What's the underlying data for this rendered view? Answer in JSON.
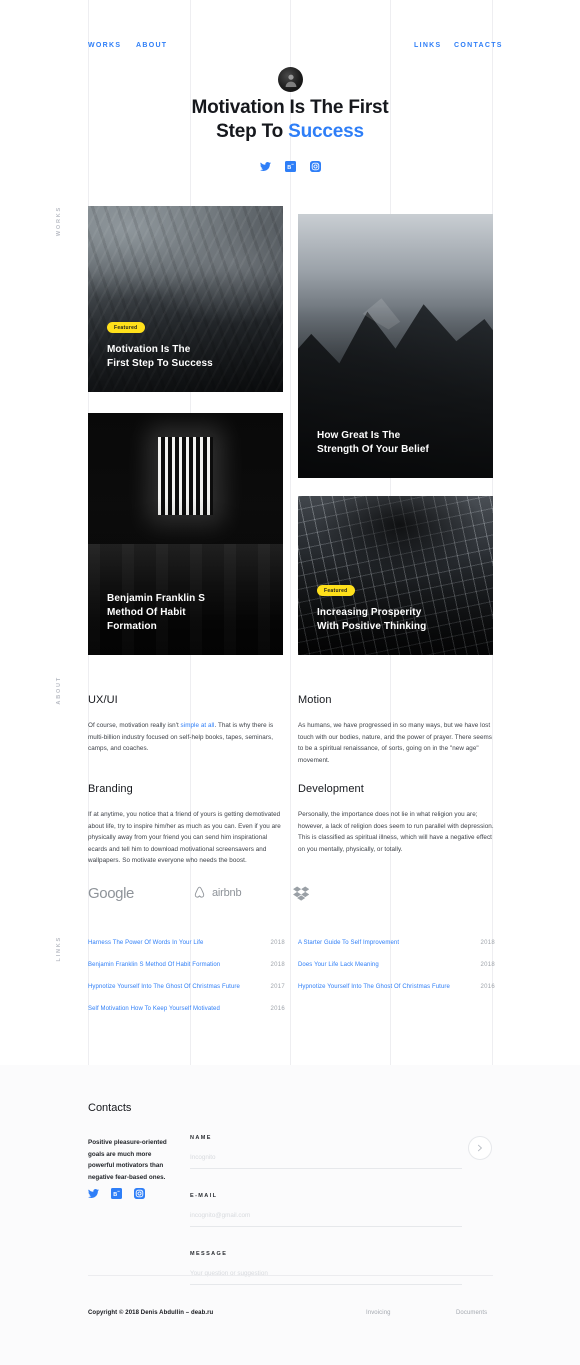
{
  "nav": {
    "works": "WORKS",
    "about": "ABOUT",
    "links": "LINKS",
    "contacts": "CONTACTS",
    "logo_icon": "avatar-logo-icon"
  },
  "hero": {
    "title_line1": "Motivation Is The First",
    "title_line2_plain": "Step To ",
    "title_line2_accent": "Success",
    "accent_color": "#2e7ef7",
    "social": [
      {
        "name": "twitter-icon",
        "label": "Twitter"
      },
      {
        "name": "behance-icon",
        "label": "Behance"
      },
      {
        "name": "instagram-icon",
        "label": "Instagram"
      }
    ]
  },
  "section_labels": {
    "works": "WORKS",
    "about": "ABOUT",
    "links": "LINKS"
  },
  "works": [
    {
      "badge": "Featured",
      "title_line1": "Motivation Is The",
      "title_line2": "First Step To Success",
      "art": "sea"
    },
    {
      "badge": "",
      "title_line1": "How Great Is The",
      "title_line2": "Strength Of Your Belief",
      "art": "mountain"
    },
    {
      "badge": "",
      "title_line1": "Benjamin Franklin S",
      "title_line2": "Method Of Habit",
      "title_line3": "Formation",
      "art": "hall"
    },
    {
      "badge": "Featured",
      "title_line1": "Increasing Prosperity",
      "title_line2": "With Positive Thinking",
      "art": "building"
    }
  ],
  "about": [
    {
      "heading": "UX/UI",
      "body_pre": "Of course, motivation really isn't ",
      "body_link": "simple at all",
      "body_post": ". That is why there is multi-billion industry focused on self-help books, tapes, seminars, camps, and coaches."
    },
    {
      "heading": "Motion",
      "body_pre": "As humans, we have progressed in so many ways, but we have lost touch with our bodies, nature, and the power of prayer. There seems to be a spiritual renaissance, of sorts, going on in the \"new age\" movement.",
      "body_link": "",
      "body_post": ""
    },
    {
      "heading": "Branding",
      "body_pre": "If at anytime, you notice that a friend of yours is getting demotivated about life, try to inspire him/her as much as you can. Even if you are physically away from your friend you can send him inspirational ecards and tell him to download motivational screensavers and wallpapers. So motivate everyone who needs the boost.",
      "body_link": "",
      "body_post": ""
    },
    {
      "heading": "Development",
      "body_pre": "Personally, the importance does not lie in what religion you are; however, a lack of religion does seem to run parallel with depression. This is classified as spiritual illness, which will have a negative effect on you mentally, physically, or totally.",
      "body_link": "",
      "body_post": ""
    }
  ],
  "clients": [
    {
      "name": "google-logo",
      "label": "Google"
    },
    {
      "name": "airbnb-logo",
      "label": "airbnb"
    },
    {
      "name": "dropbox-logo",
      "label": ""
    }
  ],
  "links_left": [
    {
      "title": "Harness The Power Of Words In Your Life",
      "year": "2018"
    },
    {
      "title": "Benjamin Franklin S Method Of Habit Formation",
      "year": "2018"
    },
    {
      "title": "Hypnotize Yourself Into The Ghost Of Christmas Future",
      "year": "2017"
    },
    {
      "title": "Self Motivation How To Keep Yourself Motivated",
      "year": "2016"
    }
  ],
  "links_right": [
    {
      "title": "A Starter Guide To Self Improvement",
      "year": "2018"
    },
    {
      "title": "Does Your Life Lack Meaning",
      "year": "2018"
    },
    {
      "title": "Hypnotize Yourself Into The Ghost Of Christmas Future",
      "year": "2016"
    }
  ],
  "contacts": {
    "heading": "Contacts",
    "note": "Positive pleasure-oriented goals are much more powerful motivators than negative fear-based ones.",
    "social": [
      {
        "name": "twitter-icon",
        "label": "Twitter"
      },
      {
        "name": "behance-icon",
        "label": "Behance"
      },
      {
        "name": "instagram-icon",
        "label": "Instagram"
      }
    ],
    "form": {
      "name_label": "NAME",
      "name_placeholder": "Incognito",
      "name_value": "",
      "email_label": "E-MAIL",
      "email_placeholder": "incognito@gmail.com",
      "email_value": "",
      "message_label": "MESSAGE",
      "message_placeholder": "Your question or suggestion",
      "message_value": "",
      "send_icon": "send-arrow-icon"
    }
  },
  "footer": {
    "copyright": "Copyright © 2018 Denis Abdullin – deab.ru",
    "invoicing": "Invoicing",
    "documents": "Documents"
  }
}
